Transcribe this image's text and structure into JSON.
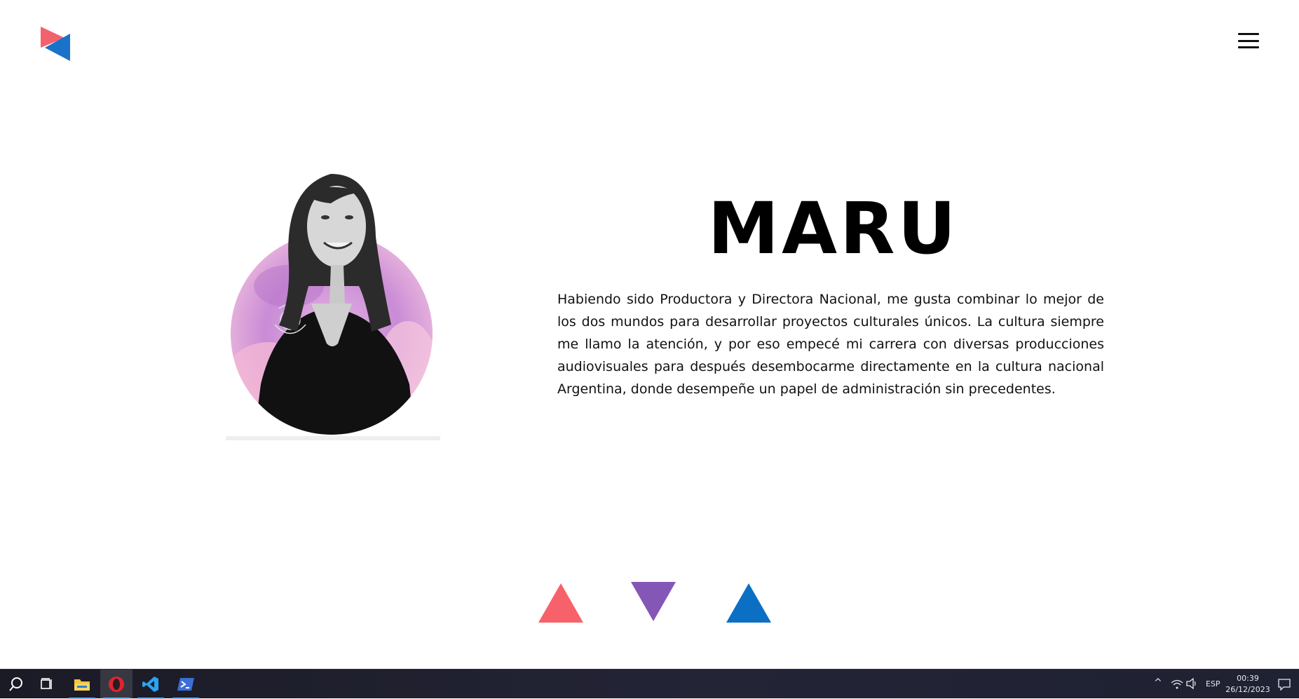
{
  "header": {
    "logo": {
      "icon": "bowtie-logo",
      "colors": [
        "#f3616c",
        "#1a73c8"
      ]
    },
    "menu_icon": "hamburger-menu-icon"
  },
  "profile": {
    "name": "MARU",
    "bio": " Habiendo sido Productora y Directora Nacional, me gusta combinar lo mejor de los dos mundos para desarrollar proyectos culturales únicos. La cultura siempre me llamo la atención, y por eso empecé mi carrera con diversas producciones audiovisuales para después desembocarme directamente en la cultura nacional Argentina, donde desempeñe un papel de administración sin precedentes.",
    "photo_icon": "profile-photo"
  },
  "decorations": {
    "triangles": [
      {
        "color": "#f7626a",
        "direction": "up"
      },
      {
        "color": "#8456b6",
        "direction": "down"
      },
      {
        "color": "#0b6fc4",
        "direction": "up"
      }
    ]
  },
  "taskbar": {
    "apps": [
      {
        "name": "search",
        "icon": "search-icon"
      },
      {
        "name": "task-view",
        "icon": "task-view-icon"
      },
      {
        "name": "file-explorer",
        "icon": "folder-icon"
      },
      {
        "name": "opera",
        "icon": "opera-icon"
      },
      {
        "name": "vscode",
        "icon": "vscode-icon"
      },
      {
        "name": "powershell",
        "icon": "powershell-icon"
      }
    ],
    "tray": {
      "language": "ESP",
      "time": "00:39",
      "date": "26/12/2023"
    }
  }
}
